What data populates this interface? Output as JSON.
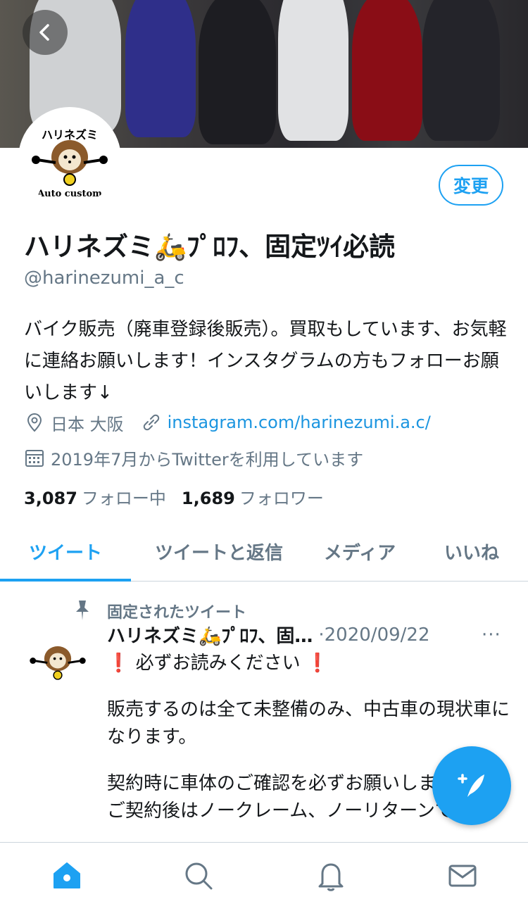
{
  "header": {
    "back_icon": "chevron-left-icon"
  },
  "profile": {
    "edit_label": "変更",
    "display_name": "ハリネズミ🛵ﾌﾟﾛﾌ、固定ﾂｲ必読",
    "handle": "@harinezumi_a_c",
    "bio": "バイク販売（廃車登録後販売）。買取もしています、お気軽に連絡お願いします！インスタグラムの方もフォローお願いします↓",
    "location": "日本 大阪",
    "website": "instagram.com/harinezumi.a.c/",
    "joined": "2019年7月からTwitterを利用しています",
    "following_count": "3,087",
    "following_label": "フォロー中",
    "followers_count": "1,689",
    "followers_label": "フォロワー",
    "avatar_text_top": "ハリネズミ",
    "avatar_text_bottom": "Auto custom"
  },
  "tabs": [
    {
      "label": "ツイート",
      "active": true
    },
    {
      "label": "ツイートと返信",
      "active": false
    },
    {
      "label": "メディア",
      "active": false
    },
    {
      "label": "いいね",
      "active": false
    }
  ],
  "tweet": {
    "pinned_label": "固定されたツイート",
    "author": "ハリネズミ🛵ﾌﾟﾛﾌ、固…",
    "date": "·2020/09/22",
    "more": "···",
    "line1": "必ずお読みください",
    "mark": "❗",
    "para2": "販売するのは全て未整備のみ、中古車の現状車になります。",
    "para3a": "契約時に車体のご確認を必ずお願いします。",
    "para3b": "ご契約後はノークレーム、ノーリターンでお"
  },
  "colors": {
    "accent": "#1da1f2",
    "secondary_text": "#657786",
    "link": "#1b95e0"
  },
  "bottom_nav": [
    "home-icon",
    "search-icon",
    "bell-icon",
    "mail-icon"
  ]
}
